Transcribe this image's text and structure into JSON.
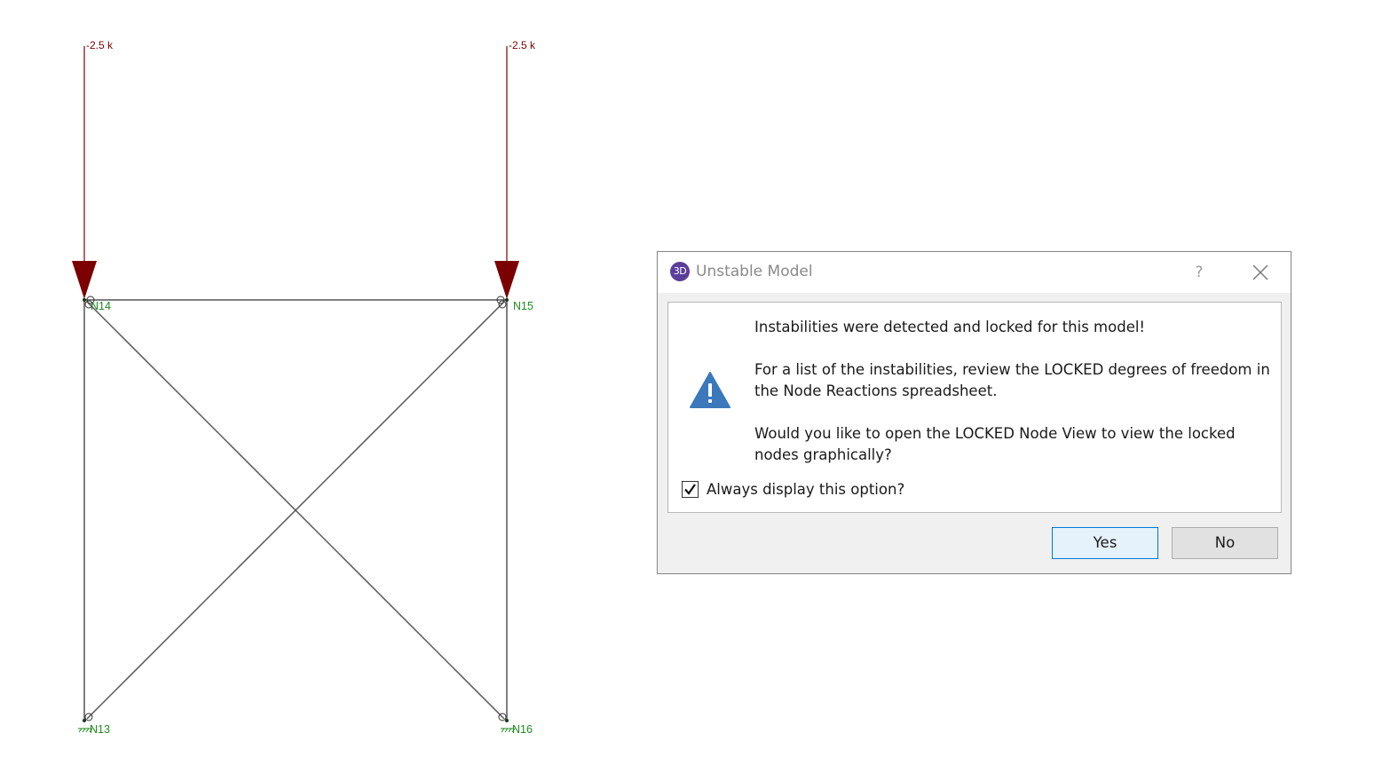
{
  "model": {
    "loads": [
      {
        "node": "N14",
        "label": "-2.5 k"
      },
      {
        "node": "N15",
        "label": "-2.5 k"
      }
    ],
    "nodes": {
      "n14": "N14",
      "n15": "N15",
      "n13": "N13",
      "n16": "N16"
    },
    "colors": {
      "load": "#7b0000",
      "node_label": "#1f8a1f",
      "member": "#555555"
    }
  },
  "dialog": {
    "app_icon_text": "3D",
    "title": "Unstable Model",
    "help_symbol": "?",
    "message_line1": "Instabilities were detected and locked for this model!",
    "message_line2": "For a list of the instabilities, review the LOCKED degrees of freedom in the Node Reactions spreadsheet.",
    "message_line3": "Would you like to open the LOCKED Node View to view the locked nodes graphically?",
    "icon": "warning-icon",
    "checkbox": {
      "label": "Always display this option?",
      "checked": true
    },
    "buttons": {
      "yes": "Yes",
      "no": "No"
    },
    "accent_color": "#0078d7",
    "warning_color": "#3b78bc"
  }
}
